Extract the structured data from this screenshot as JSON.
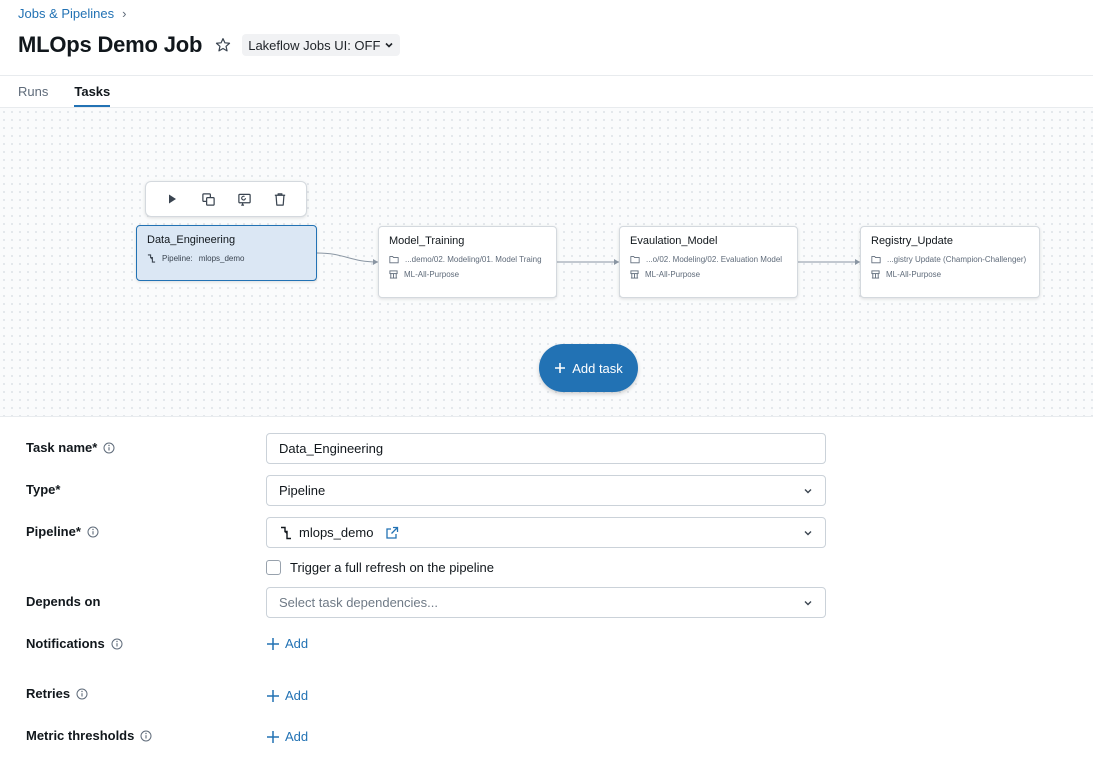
{
  "breadcrumb": {
    "label": "Jobs & Pipelines",
    "separator": "›"
  },
  "header": {
    "title": "MLOps Demo Job",
    "toggle_label": "Lakeflow Jobs UI: OFF"
  },
  "tabs": [
    {
      "label": "Runs",
      "active": false
    },
    {
      "label": "Tasks",
      "active": true
    }
  ],
  "dag": {
    "toolbar": [
      "play-icon",
      "duplicate-icon",
      "repair-icon",
      "trash-icon"
    ],
    "nodes": [
      {
        "title": "Data_Engineering",
        "line1_prefix": "Pipeline:",
        "line1": "mlops_demo",
        "selected": true
      },
      {
        "title": "Model_Training",
        "line1": "...demo/02. Modeling/01. Model Traing",
        "line2": "ML-All-Purpose"
      },
      {
        "title": "Evaulation_Model",
        "line1": "...o/02. Modeling/02. Evaluation Model",
        "line2": "ML-All-Purpose"
      },
      {
        "title": "Registry_Update",
        "line1": "...gistry Update (Champion-Challenger)",
        "line2": "ML-All-Purpose"
      }
    ],
    "add_task_label": "Add task"
  },
  "form": {
    "task_name": {
      "label": "Task name*",
      "value": "Data_Engineering"
    },
    "type": {
      "label": "Type*",
      "value": "Pipeline"
    },
    "pipeline": {
      "label": "Pipeline*",
      "value": "mlops_demo"
    },
    "full_refresh": {
      "label": "Trigger a full refresh on the pipeline",
      "checked": false
    },
    "depends_on": {
      "label": "Depends on",
      "placeholder": "Select task dependencies..."
    },
    "notifications": {
      "label": "Notifications",
      "add_label": "Add"
    },
    "retries": {
      "label": "Retries",
      "add_label": "Add"
    },
    "metric_thresholds": {
      "label": "Metric thresholds",
      "add_label": "Add"
    }
  },
  "colors": {
    "accent": "#2272b4",
    "selected_node_bg": "#dbe7f4",
    "border": "#cbd2d9"
  }
}
